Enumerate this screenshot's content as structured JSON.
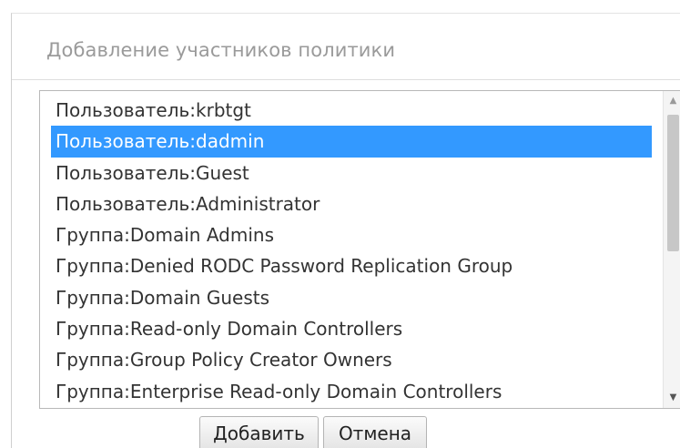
{
  "dialog": {
    "title": "Добавление участников политики"
  },
  "members_list": {
    "items": [
      {
        "label": "Пользователь:krbtgt",
        "selected": false
      },
      {
        "label": "Пользователь:dadmin",
        "selected": true
      },
      {
        "label": "Пользователь:Guest",
        "selected": false
      },
      {
        "label": "Пользователь:Administrator",
        "selected": false
      },
      {
        "label": "Группа:Domain Admins",
        "selected": false
      },
      {
        "label": "Группа:Denied RODC Password Replication Group",
        "selected": false
      },
      {
        "label": "Группа:Domain Guests",
        "selected": false
      },
      {
        "label": "Группа:Read-only Domain Controllers",
        "selected": false
      },
      {
        "label": "Группа:Group Policy Creator Owners",
        "selected": false
      },
      {
        "label": "Группа:Enterprise Read-only Domain Controllers",
        "selected": false
      }
    ],
    "scroll": {
      "up_icon": "triangle-up-icon",
      "down_icon": "triangle-down-icon"
    }
  },
  "buttons": {
    "add_label": "Добавить",
    "cancel_label": "Отмена"
  },
  "colors": {
    "selection": "#3399ff",
    "title_text": "#9a9a9a"
  }
}
